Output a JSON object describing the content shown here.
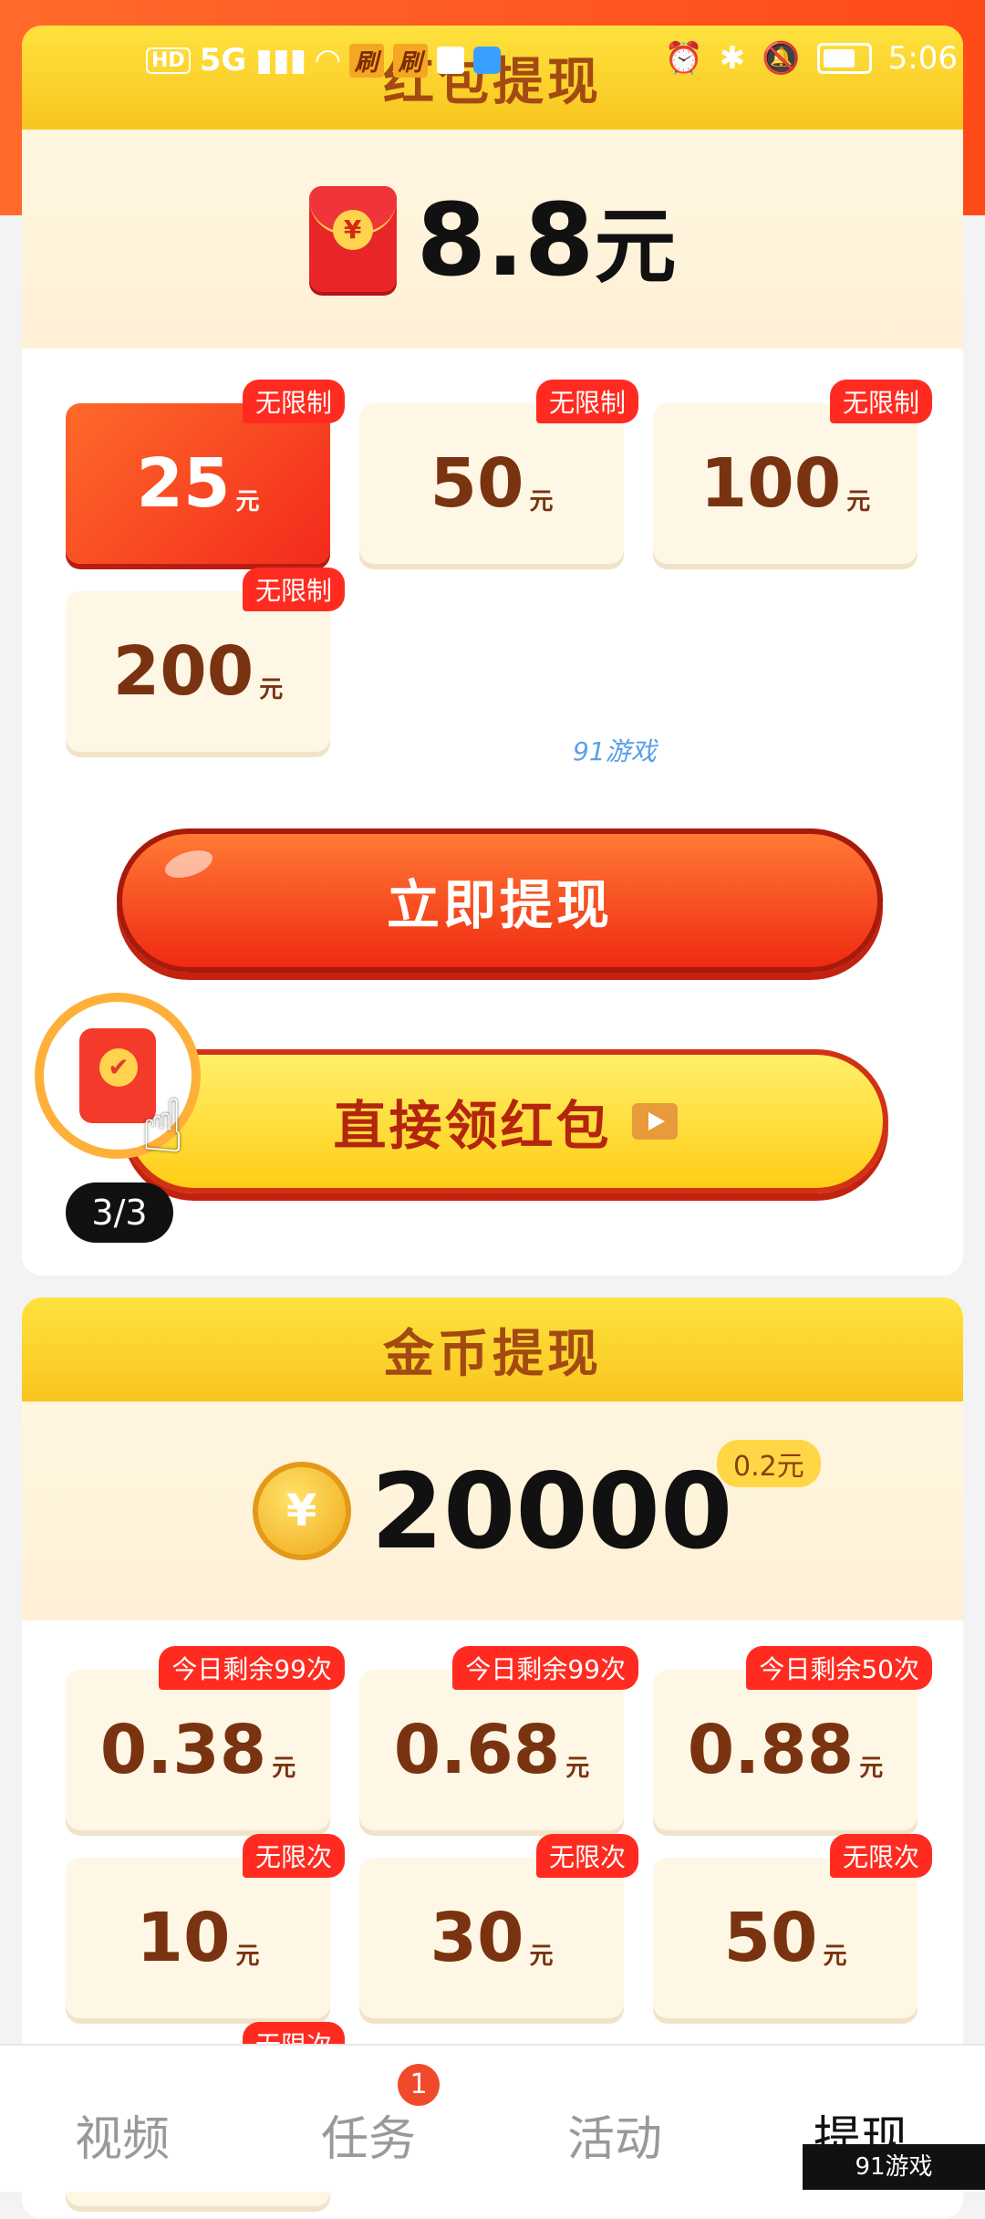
{
  "status": {
    "left_chips": [
      "HD",
      "5G",
      "刷",
      "刷"
    ],
    "time": "5:06"
  },
  "redpacket_section": {
    "title": "红包提现",
    "amount": "8.8",
    "amount_unit": "元",
    "options": [
      {
        "value": "25",
        "unit": "元",
        "tag": "无限制",
        "selected": true
      },
      {
        "value": "50",
        "unit": "元",
        "tag": "无限制",
        "selected": false
      },
      {
        "value": "100",
        "unit": "元",
        "tag": "无限制",
        "selected": false
      },
      {
        "value": "200",
        "unit": "元",
        "tag": "无限制",
        "selected": false
      }
    ],
    "watermark": "91游戏",
    "withdraw_button": "立即提现",
    "redpacket_button": "直接领红包",
    "counter": "3/3"
  },
  "coin_section": {
    "title": "金币提现",
    "amount": "20000",
    "badge": "0.2元",
    "options": [
      {
        "value": "0.38",
        "unit": "元",
        "tag": "今日剩余99次"
      },
      {
        "value": "0.68",
        "unit": "元",
        "tag": "今日剩余99次"
      },
      {
        "value": "0.88",
        "unit": "元",
        "tag": "今日剩余50次"
      },
      {
        "value": "10",
        "unit": "元",
        "tag": "无限次"
      },
      {
        "value": "30",
        "unit": "元",
        "tag": "无限次"
      },
      {
        "value": "50",
        "unit": "元",
        "tag": "无限次"
      }
    ],
    "partial_tag": "无限次"
  },
  "tabs": [
    {
      "label": "视频",
      "active": false
    },
    {
      "label": "任务",
      "active": false,
      "badge": "1"
    },
    {
      "label": "活动",
      "active": false
    },
    {
      "label": "提现",
      "active": true
    }
  ],
  "corner_logo": "91游戏"
}
